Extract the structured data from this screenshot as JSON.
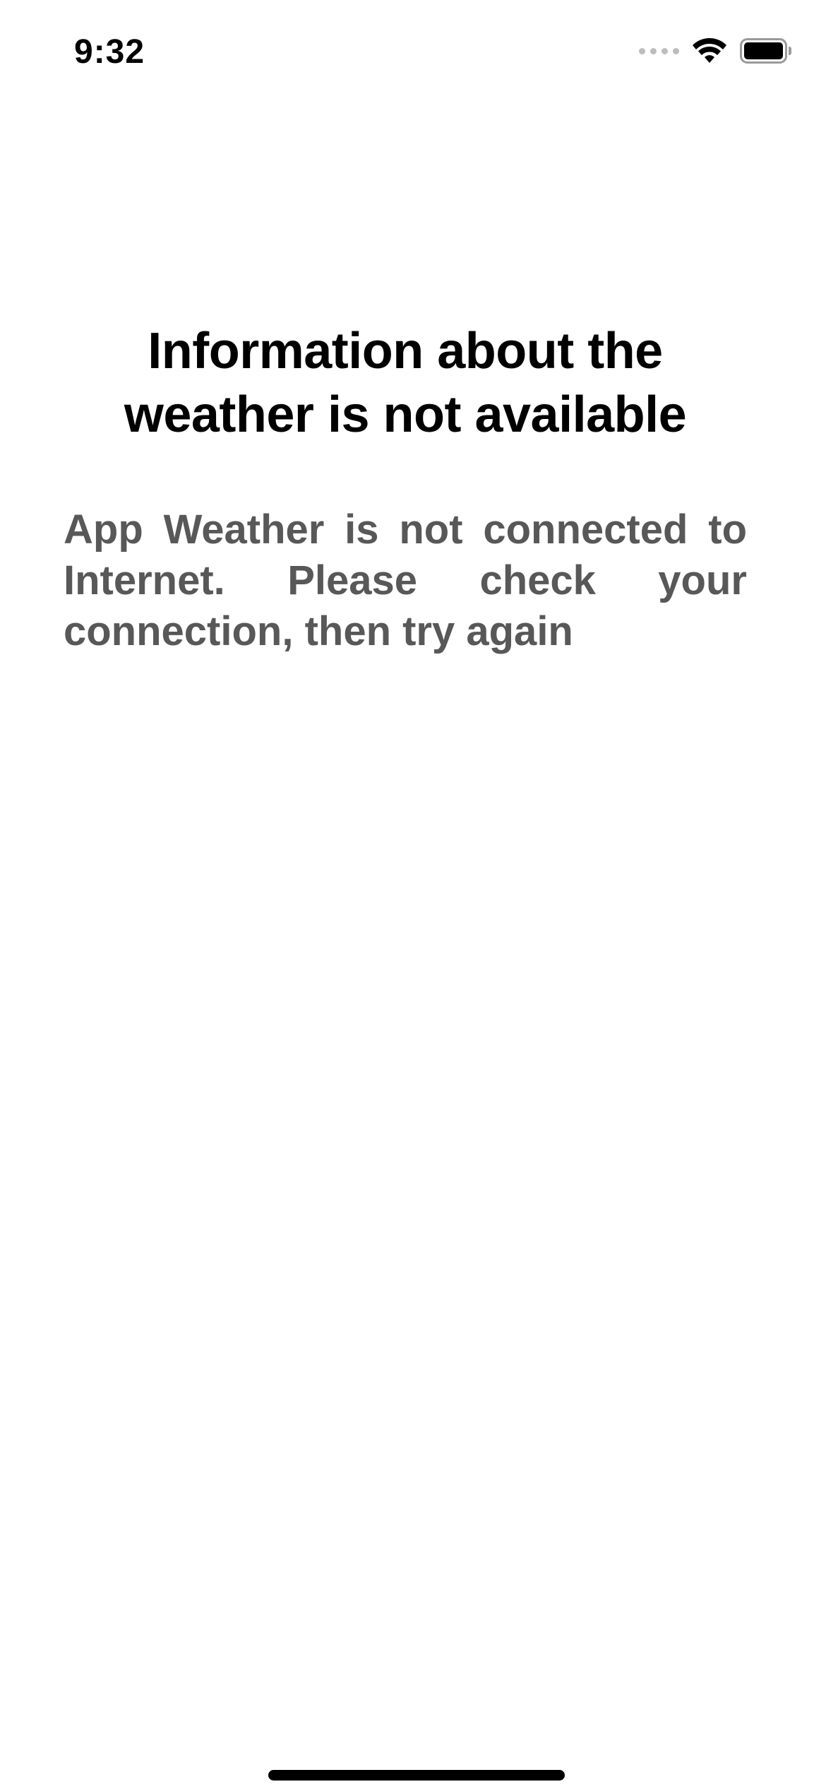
{
  "status_bar": {
    "time": "9:32",
    "icons": [
      "cellular-signal-icon",
      "wifi-icon",
      "battery-icon"
    ]
  },
  "main": {
    "headline": "Information about the weather is not available",
    "message": "App Weather is not connected to Internet. Please check your connection, then try again"
  },
  "colors": {
    "background": "#ffffff",
    "headline": "#000000",
    "message": "#585858",
    "signal_inactive": "#bdbdbd"
  }
}
